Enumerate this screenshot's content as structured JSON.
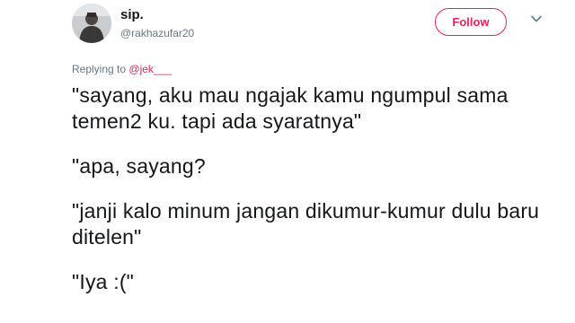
{
  "author": {
    "name": "sip.",
    "handle": "@rakhazufar20"
  },
  "follow_button": {
    "label": "Follow",
    "color": "#e0245e"
  },
  "menu_icon": "chevron-down-icon",
  "reply": {
    "prefix": "Replying to",
    "mention": "@jek___"
  },
  "tweet": {
    "paragraphs": [
      "\"sayang, aku mau ngajak kamu ngumpul sama temen2 ku. tapi ada syaratnya\"",
      "\"apa, sayang?",
      "\"janji kalo minum jangan dikumur-kumur dulu baru ditelen\"",
      "\"Iya :(\""
    ]
  }
}
